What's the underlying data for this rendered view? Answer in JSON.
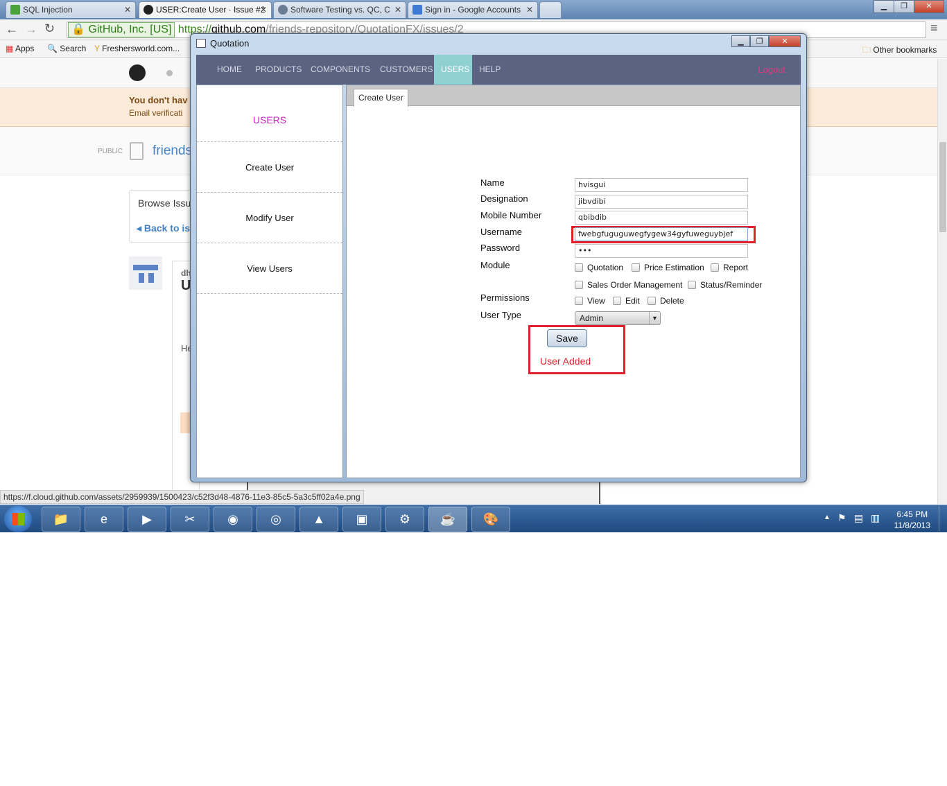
{
  "browser": {
    "tabs": [
      {
        "title": "SQL Injection",
        "favicon_color": "#49a23c"
      },
      {
        "title": "USER:Create User · Issue #2",
        "favicon_color": "#222222"
      },
      {
        "title": "Software Testing vs. QC, C",
        "favicon_color": "#6b7d93"
      },
      {
        "title": "Sign in - Google Accounts",
        "favicon_color": "#3d7ad6"
      }
    ],
    "ssl_label": "GitHub, Inc. [US]",
    "url_scheme": "https://",
    "url_host": "github.com",
    "url_path": "/friends-repository/QuotationFX/issues/2",
    "bookmarks": [
      "Apps",
      "Search",
      "Freshersworld.com...",
      "Other bookmarks"
    ],
    "status_url": "https://f.cloud.github.com/assets/2959939/1500423/c52f3d48-4876-11e3-85c5-5a3c5ff02a4e.png"
  },
  "github_bg": {
    "warning_title": "You don't hav",
    "warning_sub": "Email verificati",
    "public_label": "PUBLIC",
    "repo_name": "friends",
    "browse": "Browse Issu",
    "back": "Back to iss",
    "issue_initial": "U",
    "issue_user": "dh",
    "comment_text": "He"
  },
  "quotation": {
    "title": "Quotation",
    "nav": [
      "HOME",
      "PRODUCTS",
      "COMPONENTS",
      "CUSTOMERS",
      "USERS",
      "HELP"
    ],
    "nav_active_index": 4,
    "logout": "Logout",
    "sidebar": {
      "header": "USERS",
      "items": [
        "Create User",
        "Modify User",
        "View Users"
      ]
    },
    "tab_label": "Create User",
    "form": {
      "name_label": "Name",
      "name_value": "hvisgui",
      "designation_label": "Designation",
      "designation_value": "jibvdibi",
      "mobile_label": "Mobile Number",
      "mobile_value": "qbibdib",
      "username_label": "Username",
      "username_value": "fwebgfuguguwegfygew34gyfuweguybjef",
      "password_label": "Password",
      "password_value": "•••",
      "module_label": "Module",
      "modules": [
        "Quotation",
        "Price Estimation",
        "Report",
        "Sales Order Management",
        "Status/Reminder"
      ],
      "permissions_label": "Permissions",
      "permissions": [
        "View",
        "Edit",
        "Delete"
      ],
      "user_type_label": "User Type",
      "user_type_value": "Admin",
      "save_label": "Save",
      "result_message": "User Added"
    },
    "colors": {
      "nav_bg": "#5a6482",
      "nav_active": "#8fd0d2",
      "logout": "#e0397d",
      "sidebar_header": "#cc22cc",
      "highlight_box": "#e0202a",
      "message": "#e0202a"
    }
  },
  "taskbar": {
    "time": "6:45 PM",
    "date": "11/8/2013",
    "apps": [
      "explorer",
      "internet-explorer",
      "media-player",
      "tools",
      "firefox",
      "chrome",
      "acrobat",
      "remote-desktop",
      "java-ee-ide",
      "java",
      "paint"
    ]
  }
}
